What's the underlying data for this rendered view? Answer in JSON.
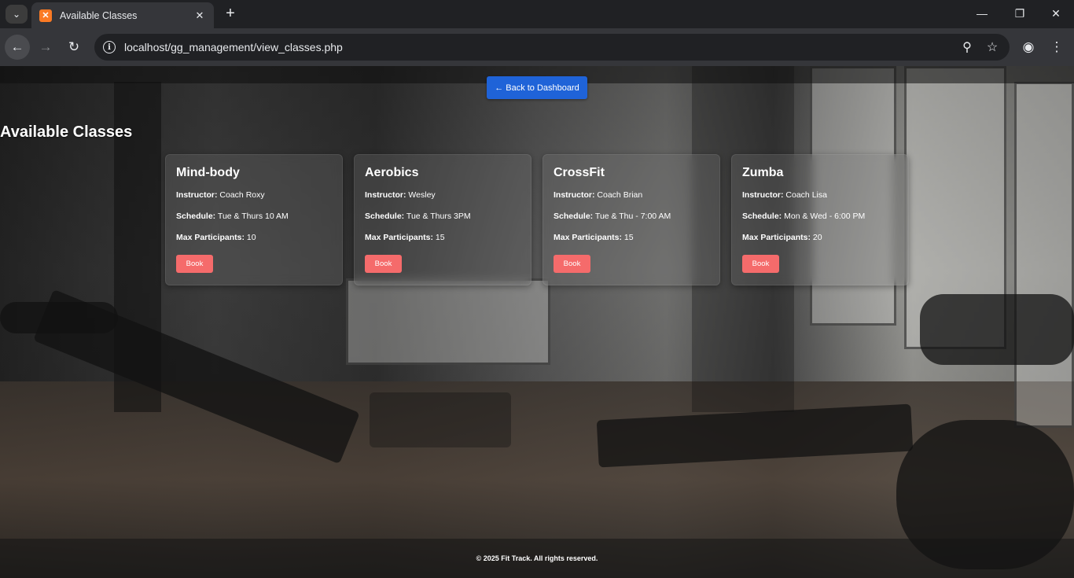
{
  "browser": {
    "tab_title": "Available Classes",
    "url": "localhost/gg_management/view_classes.php",
    "favicon_letter": "✖"
  },
  "page": {
    "back_button": "← Back to Dashboard",
    "title": "Available Classes",
    "labels": {
      "instructor": "Instructor:",
      "schedule": "Schedule:",
      "max": "Max Participants:"
    },
    "book_label": "Book",
    "classes": [
      {
        "name": "Mind-body",
        "instructor": "Coach Roxy",
        "schedule": "Tue & Thurs 10 AM",
        "max": "10"
      },
      {
        "name": "Aerobics",
        "instructor": "Wesley",
        "schedule": "Tue & Thurs 3PM",
        "max": "15"
      },
      {
        "name": "CrossFit",
        "instructor": "Coach Brian",
        "schedule": "Tue & Thu - 7:00 AM",
        "max": "15"
      },
      {
        "name": "Zumba",
        "instructor": "Coach Lisa",
        "schedule": "Mon & Wed - 6:00 PM",
        "max": "20"
      }
    ],
    "footer": "© 2025 Fit Track. All rights reserved."
  },
  "colors": {
    "primary_button": "#1f63d8",
    "book_button": "#f56b6b"
  }
}
